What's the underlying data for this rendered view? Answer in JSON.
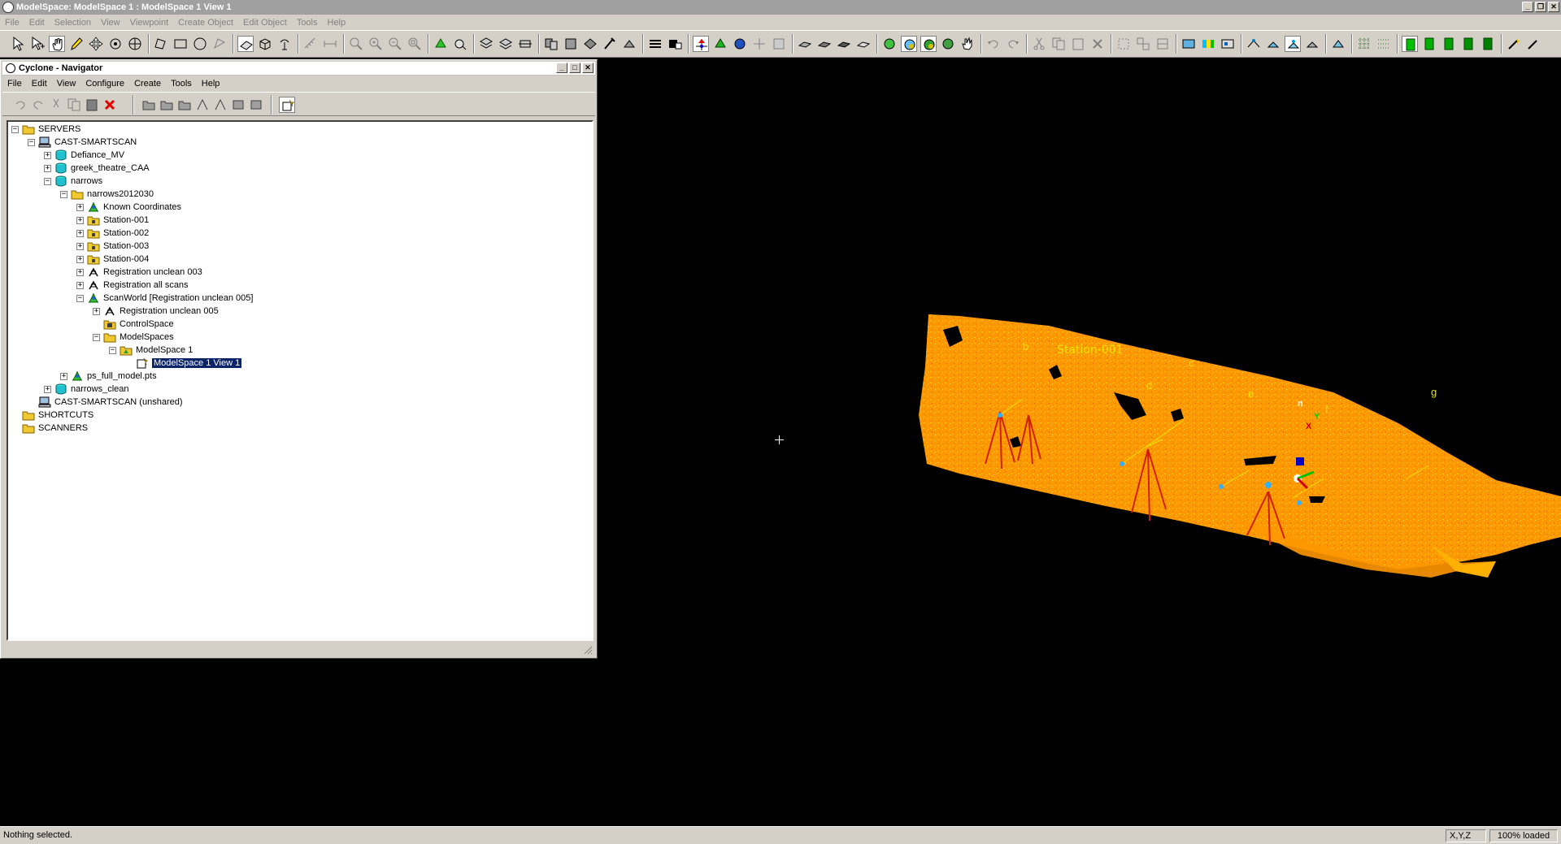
{
  "window": {
    "title": "ModelSpace: ModelSpace 1 : ModelSpace 1 View 1"
  },
  "menu": [
    "File",
    "Edit",
    "Selection",
    "View",
    "Viewpoint",
    "Create Object",
    "Edit Object",
    "Tools",
    "Help"
  ],
  "navigator": {
    "title": "Cyclone - Navigator",
    "menu": [
      "File",
      "Edit",
      "View",
      "Configure",
      "Create",
      "Tools",
      "Help"
    ],
    "tree": [
      {
        "label": "SERVERS",
        "level": 0,
        "exp": "−",
        "icon": "folder"
      },
      {
        "label": "CAST-SMARTSCAN",
        "level": 1,
        "exp": "−",
        "icon": "computer"
      },
      {
        "label": "Defiance_MV",
        "level": 2,
        "exp": "+",
        "icon": "database"
      },
      {
        "label": "greek_theatre_CAA",
        "level": 2,
        "exp": "+",
        "icon": "database"
      },
      {
        "label": "narrows",
        "level": 2,
        "exp": "−",
        "icon": "database"
      },
      {
        "label": "narrows2012030",
        "level": 3,
        "exp": "−",
        "icon": "folder"
      },
      {
        "label": "Known Coordinates",
        "level": 4,
        "exp": "+",
        "icon": "scanworld"
      },
      {
        "label": "Station-001",
        "level": 4,
        "exp": "+",
        "icon": "station"
      },
      {
        "label": "Station-002",
        "level": 4,
        "exp": "+",
        "icon": "station"
      },
      {
        "label": "Station-003",
        "level": 4,
        "exp": "+",
        "icon": "station"
      },
      {
        "label": "Station-004",
        "level": 4,
        "exp": "+",
        "icon": "station"
      },
      {
        "label": "Registration unclean 003",
        "level": 4,
        "exp": "+",
        "icon": "registration"
      },
      {
        "label": "Registration all scans",
        "level": 4,
        "exp": "+",
        "icon": "registration"
      },
      {
        "label": "ScanWorld [Registration unclean 005]",
        "level": 4,
        "exp": "−",
        "icon": "scanworld"
      },
      {
        "label": "Registration unclean 005",
        "level": 5,
        "exp": "+",
        "icon": "registration"
      },
      {
        "label": "ControlSpace",
        "level": 5,
        "exp": "",
        "icon": "controlspace"
      },
      {
        "label": "ModelSpaces",
        "level": 5,
        "exp": "−",
        "icon": "folder"
      },
      {
        "label": "ModelSpace 1",
        "level": 6,
        "exp": "−",
        "icon": "modelspace"
      },
      {
        "label": "ModelSpace 1 View 1",
        "level": 7,
        "exp": "",
        "icon": "view",
        "selected": true
      },
      {
        "label": "ps_full_model.pts",
        "level": 3,
        "exp": "+",
        "icon": "scanworld"
      },
      {
        "label": "narrows_clean",
        "level": 2,
        "exp": "+",
        "icon": "database"
      },
      {
        "label": "CAST-SMARTSCAN (unshared)",
        "level": 1,
        "exp": "",
        "icon": "computer"
      },
      {
        "label": "SHORTCUTS",
        "level": 0,
        "exp": "",
        "icon": "folder"
      },
      {
        "label": "SCANNERS",
        "level": 0,
        "exp": "",
        "icon": "folder"
      }
    ]
  },
  "viewport": {
    "labels": {
      "station": "Station-001",
      "b": "b",
      "c": "c",
      "d": "d",
      "e": "e",
      "f": "f",
      "g": "g",
      "axis_n": "n",
      "axis_y": "Y",
      "axis_x": "X"
    }
  },
  "status": {
    "text": "Nothing selected.",
    "coords": "X,Y,Z",
    "loaded": "100% loaded"
  },
  "colors": {
    "cloud": "#ff9a00",
    "cloud_dark": "#e06000",
    "label": "#e6e600",
    "tripod": "#cc2200",
    "selection": "#0a246a"
  }
}
